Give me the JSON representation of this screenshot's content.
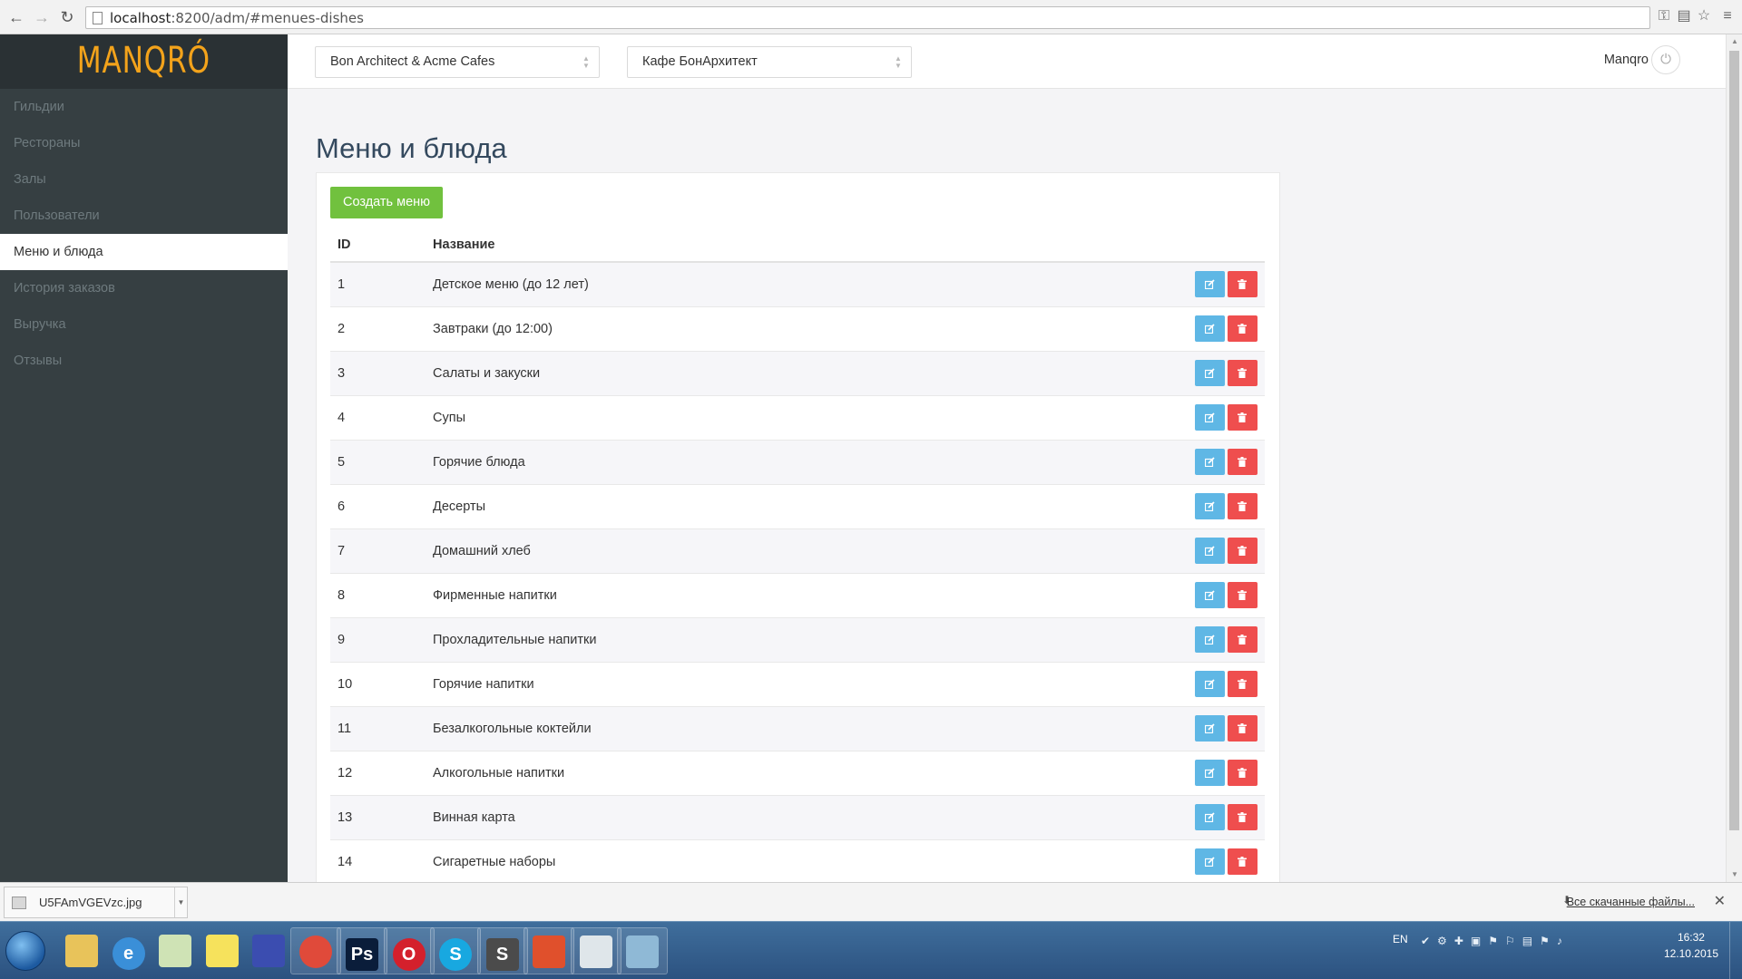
{
  "browser": {
    "url_host": "localhost",
    "url_path": ":8200/adm/#menues-dishes"
  },
  "sidebar": {
    "logo": "MANQRÓ",
    "items": [
      {
        "label": "Гильдии",
        "active": false
      },
      {
        "label": "Рестораны",
        "active": false
      },
      {
        "label": "Залы",
        "active": false
      },
      {
        "label": "Пользователи",
        "active": false
      },
      {
        "label": "Меню и блюда",
        "active": true
      },
      {
        "label": "История заказов",
        "active": false
      },
      {
        "label": "Выручка",
        "active": false
      },
      {
        "label": "Отзывы",
        "active": false
      }
    ]
  },
  "header": {
    "select_company": "Bon Architect & Acme Cafes",
    "select_cafe": "Кафе БонАрхитект",
    "user_name": "Manqro"
  },
  "main": {
    "title": "Меню и блюда",
    "create_button": "Создать меню",
    "table": {
      "columns": [
        "ID",
        "Название"
      ],
      "rows": [
        {
          "id": "1",
          "name": "Детское меню (до 12 лет)"
        },
        {
          "id": "2",
          "name": "Завтраки (до 12:00)"
        },
        {
          "id": "3",
          "name": "Салаты и закуски"
        },
        {
          "id": "4",
          "name": "Супы"
        },
        {
          "id": "5",
          "name": "Горячие блюда"
        },
        {
          "id": "6",
          "name": "Десерты"
        },
        {
          "id": "7",
          "name": "Домашний хлеб"
        },
        {
          "id": "8",
          "name": "Фирменные напитки"
        },
        {
          "id": "9",
          "name": "Прохладительные напитки"
        },
        {
          "id": "10",
          "name": "Горячие напитки"
        },
        {
          "id": "11",
          "name": "Безалкогольные коктейли"
        },
        {
          "id": "12",
          "name": "Алкогольные напитки"
        },
        {
          "id": "13",
          "name": "Винная карта"
        },
        {
          "id": "14",
          "name": "Сигаретные наборы"
        }
      ]
    }
  },
  "downloads": {
    "file_name": "U5FAmVGEVzc.jpg",
    "all_downloads": "Все скачанные файлы..."
  },
  "taskbar": {
    "lang": "EN",
    "time": "16:32",
    "date": "12.10.2015",
    "apps": [
      {
        "name": "explorer",
        "glyph": "",
        "color": "#e8c35a"
      },
      {
        "name": "ie",
        "glyph": "e",
        "color": "#3a8fd8"
      },
      {
        "name": "chart-app",
        "glyph": "",
        "color": "#cfe3b5"
      },
      {
        "name": "sticky",
        "glyph": "",
        "color": "#f6e25c"
      },
      {
        "name": "save-app",
        "glyph": "",
        "color": "#3b4db0"
      },
      {
        "name": "chrome",
        "glyph": "",
        "color": "#e04a3a"
      },
      {
        "name": "photoshop",
        "glyph": "Ps",
        "color": "#0a1d3a"
      },
      {
        "name": "opera",
        "glyph": "O",
        "color": "#d4202c"
      },
      {
        "name": "skype",
        "glyph": "S",
        "color": "#18a8e0"
      },
      {
        "name": "sublime",
        "glyph": "S",
        "color": "#4b4b4b"
      },
      {
        "name": "git",
        "glyph": "",
        "color": "#e0502c"
      },
      {
        "name": "window-app",
        "glyph": "",
        "color": "#dfe6ea"
      },
      {
        "name": "virtualbox",
        "glyph": "",
        "color": "#8fb9d6"
      }
    ]
  },
  "colors": {
    "accent_green": "#71c13e",
    "edit_blue": "#5fb7e5",
    "delete_red": "#ef4e4e",
    "logo_orange": "#f3a31b",
    "sidebar_bg": "#363f42"
  }
}
